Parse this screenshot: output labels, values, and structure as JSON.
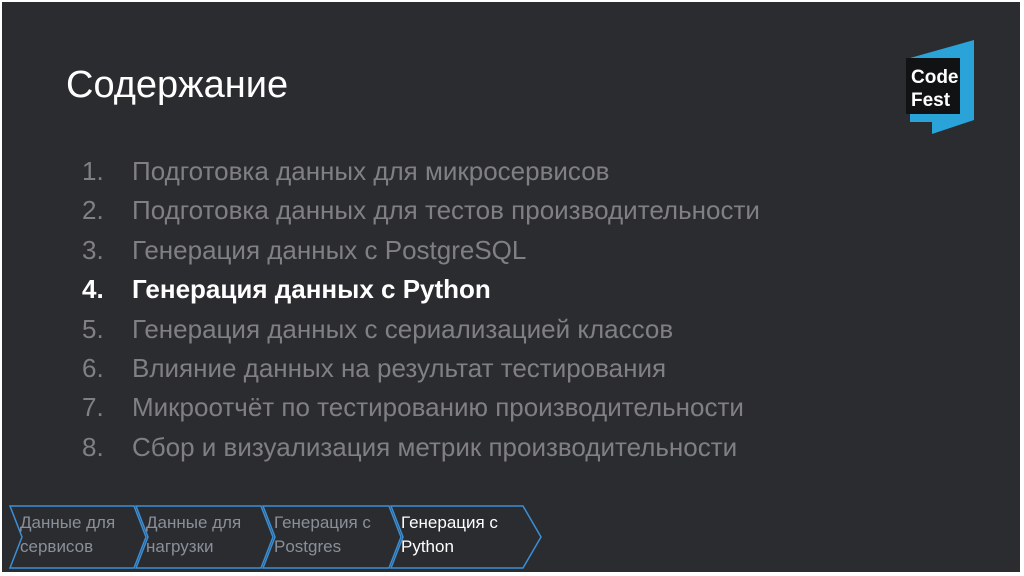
{
  "slide": {
    "title": "Содержание"
  },
  "logo": {
    "line1": "Code",
    "line2": "Fest",
    "color": "#2aa3d8"
  },
  "agenda": {
    "items": [
      {
        "num": "1.",
        "text": "Подготовка данных для микросервисов"
      },
      {
        "num": "2.",
        "text": "Подготовка данных для тестов производительности"
      },
      {
        "num": "3.",
        "text": "Генерация данных с PostgreSQL"
      },
      {
        "num": "4.",
        "text": "Генерация данных с Python",
        "active": true
      },
      {
        "num": "5.",
        "text": "Генерация данных с сериализацией классов"
      },
      {
        "num": "6.",
        "text": "Влияние данных на результат тестирования"
      },
      {
        "num": "7.",
        "text": "Микроотчёт по тестированию производительности"
      },
      {
        "num": "8.",
        "text": "Сбор и визуализация метрик производительности"
      }
    ]
  },
  "breadcrumbs": {
    "steps": [
      {
        "line1": "Данные для",
        "line2": "сервисов"
      },
      {
        "line1": "Данные для",
        "line2": "нагрузки"
      },
      {
        "line1": "Генерация с",
        "line2": "Postgres"
      },
      {
        "line1": "Генерация с",
        "line2": "Python",
        "current": true
      }
    ],
    "outline_color": "#3b8fd6"
  }
}
